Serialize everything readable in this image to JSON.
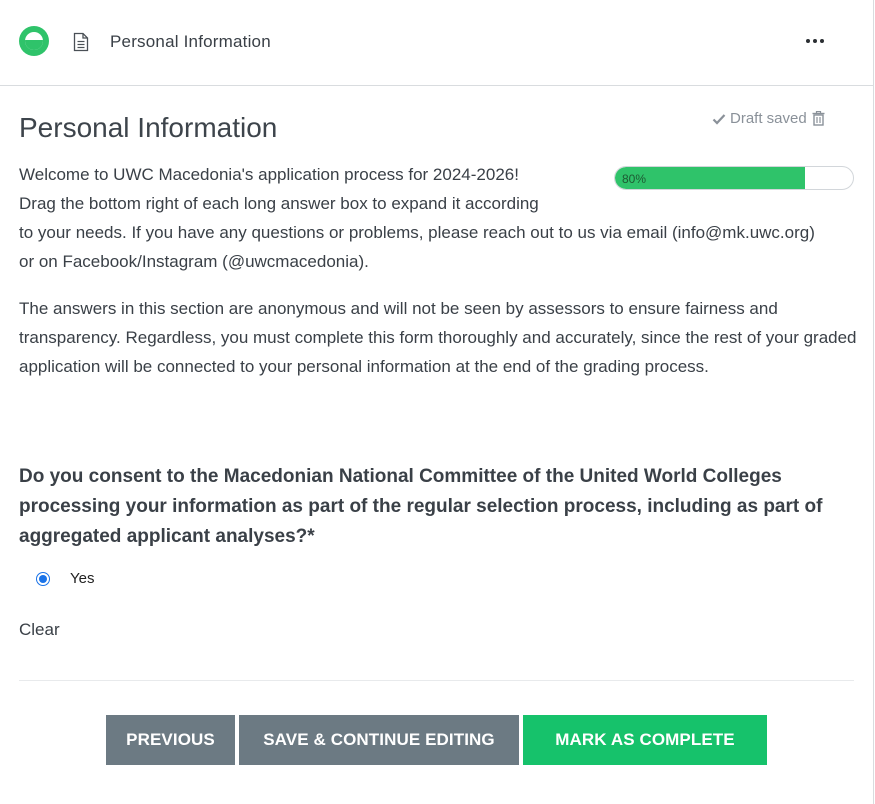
{
  "header": {
    "title": "Personal Information",
    "status_color": "#2fc36a",
    "icons": [
      "status-circle-icon",
      "document-icon",
      "more-options-icon"
    ]
  },
  "main": {
    "title": "Personal Information",
    "draft_status": "Draft saved",
    "progress": {
      "percent": 80,
      "label": "80%",
      "color": "#2fc36a"
    },
    "intro_line1": "Welcome to UWC Macedonia's application process for 2024-2026!",
    "intro_line2": "Drag the bottom right of each long answer box to expand it according",
    "intro_line3": "to your needs. If you have any questions or problems, please reach out to us via email (info@mk.uwc.org) or on Facebook/Instagram (@uwcmacedonia).",
    "paragraph2": "The answers in this section are anonymous and will not be seen by assessors to ensure fairness and transparency. Regardless, you must complete this form thoroughly and accurately, since the rest of your graded application will be connected to your personal information at the end of the grading process.",
    "question": "Do you consent to the Macedonian National Committee of the United World Colleges processing your information as part of the regular selection process, including as part of aggregated applicant analyses?*",
    "options": [
      {
        "label": "Yes",
        "selected": true
      }
    ],
    "clear_label": "Clear"
  },
  "actions": {
    "previous_label": "PREVIOUS",
    "save_label": "SAVE & CONTINUE EDITING",
    "complete_label": "MARK AS COMPLETE",
    "complete_color": "#16c26b",
    "secondary_color": "#6c7a83"
  }
}
